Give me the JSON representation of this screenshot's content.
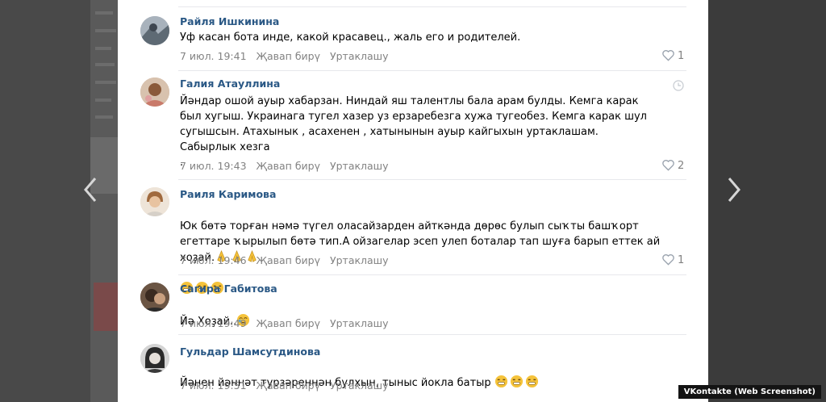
{
  "comments": [
    {
      "author": "Райля Ишкинина",
      "text": "Уф касан бота инде, какой красавец., жаль его и родителей.",
      "time": "7 июл. 19:41",
      "reply": "Җавап бирү",
      "share": "Уртаклашу",
      "likes": "1",
      "avatar_icon": "avatar-photo"
    },
    {
      "author": "Галия Атауллина",
      "text": "Йәндар ошой ауыр хабарзан. Ниндай яш талентлы бала арам булды. Кемга карак был хугыш. Украинага тугел хазер уз ерзаребезга хужа тугеобез. Кемга карак шул сугышсын. Атахынык , асахенен , хатынынын ауыр кайгыхын уртаклашам. Сабырлык хезга\n.",
      "time": "7 июл. 19:43",
      "reply": "Җавап бирү",
      "share": "Уртаклашу",
      "likes": "2",
      "avatar_icon": "avatar-photo"
    },
    {
      "author": "Раиля Каримова",
      "text": "Юк бөтә торған нәмә түгел оласайзарден айткәнда дөрөс булып сыҡты башҡорт егеттаре ҡырылып бөтә тип.А ойзагелар эсеп улеп боталар тап шуға барып еттек ай хоҙай.",
      "time": "7 июл. 19:46",
      "reply": "Җавап бирү",
      "share": "Уртаклашу",
      "likes": "1",
      "avatar_icon": "avatar-photo"
    },
    {
      "author": "Сагира Габитова",
      "text": "Йә Хоҙай..",
      "time": "7 июл. 19:49",
      "reply": "Җавап бирү",
      "share": "Уртаклашу",
      "likes": "",
      "avatar_icon": "avatar-photo"
    },
    {
      "author": "Гульдар Шамсутдинова",
      "text": "Йәнен йәннәт турзәреннән булхын, тыныс йокла батыр",
      "time": "7 июл. 19:51",
      "reply": "Җавап бирү",
      "share": "Уртаклашу",
      "likes": "",
      "avatar_icon": "avatar-photo"
    }
  ],
  "caption": "VKontakte (Web Screenshot)",
  "icons": {
    "like": "heart-icon",
    "prev": "chevron-left-icon",
    "next": "chevron-right-icon",
    "clock": "clock-icon",
    "emoji_cry": "crying-face-emoji",
    "emoji_pray": "praying-hands-emoji"
  },
  "colors": {
    "author": "#2a5885",
    "meta": "#828282",
    "separator": "#e7e8ec",
    "emoji": "#f5c33b"
  }
}
